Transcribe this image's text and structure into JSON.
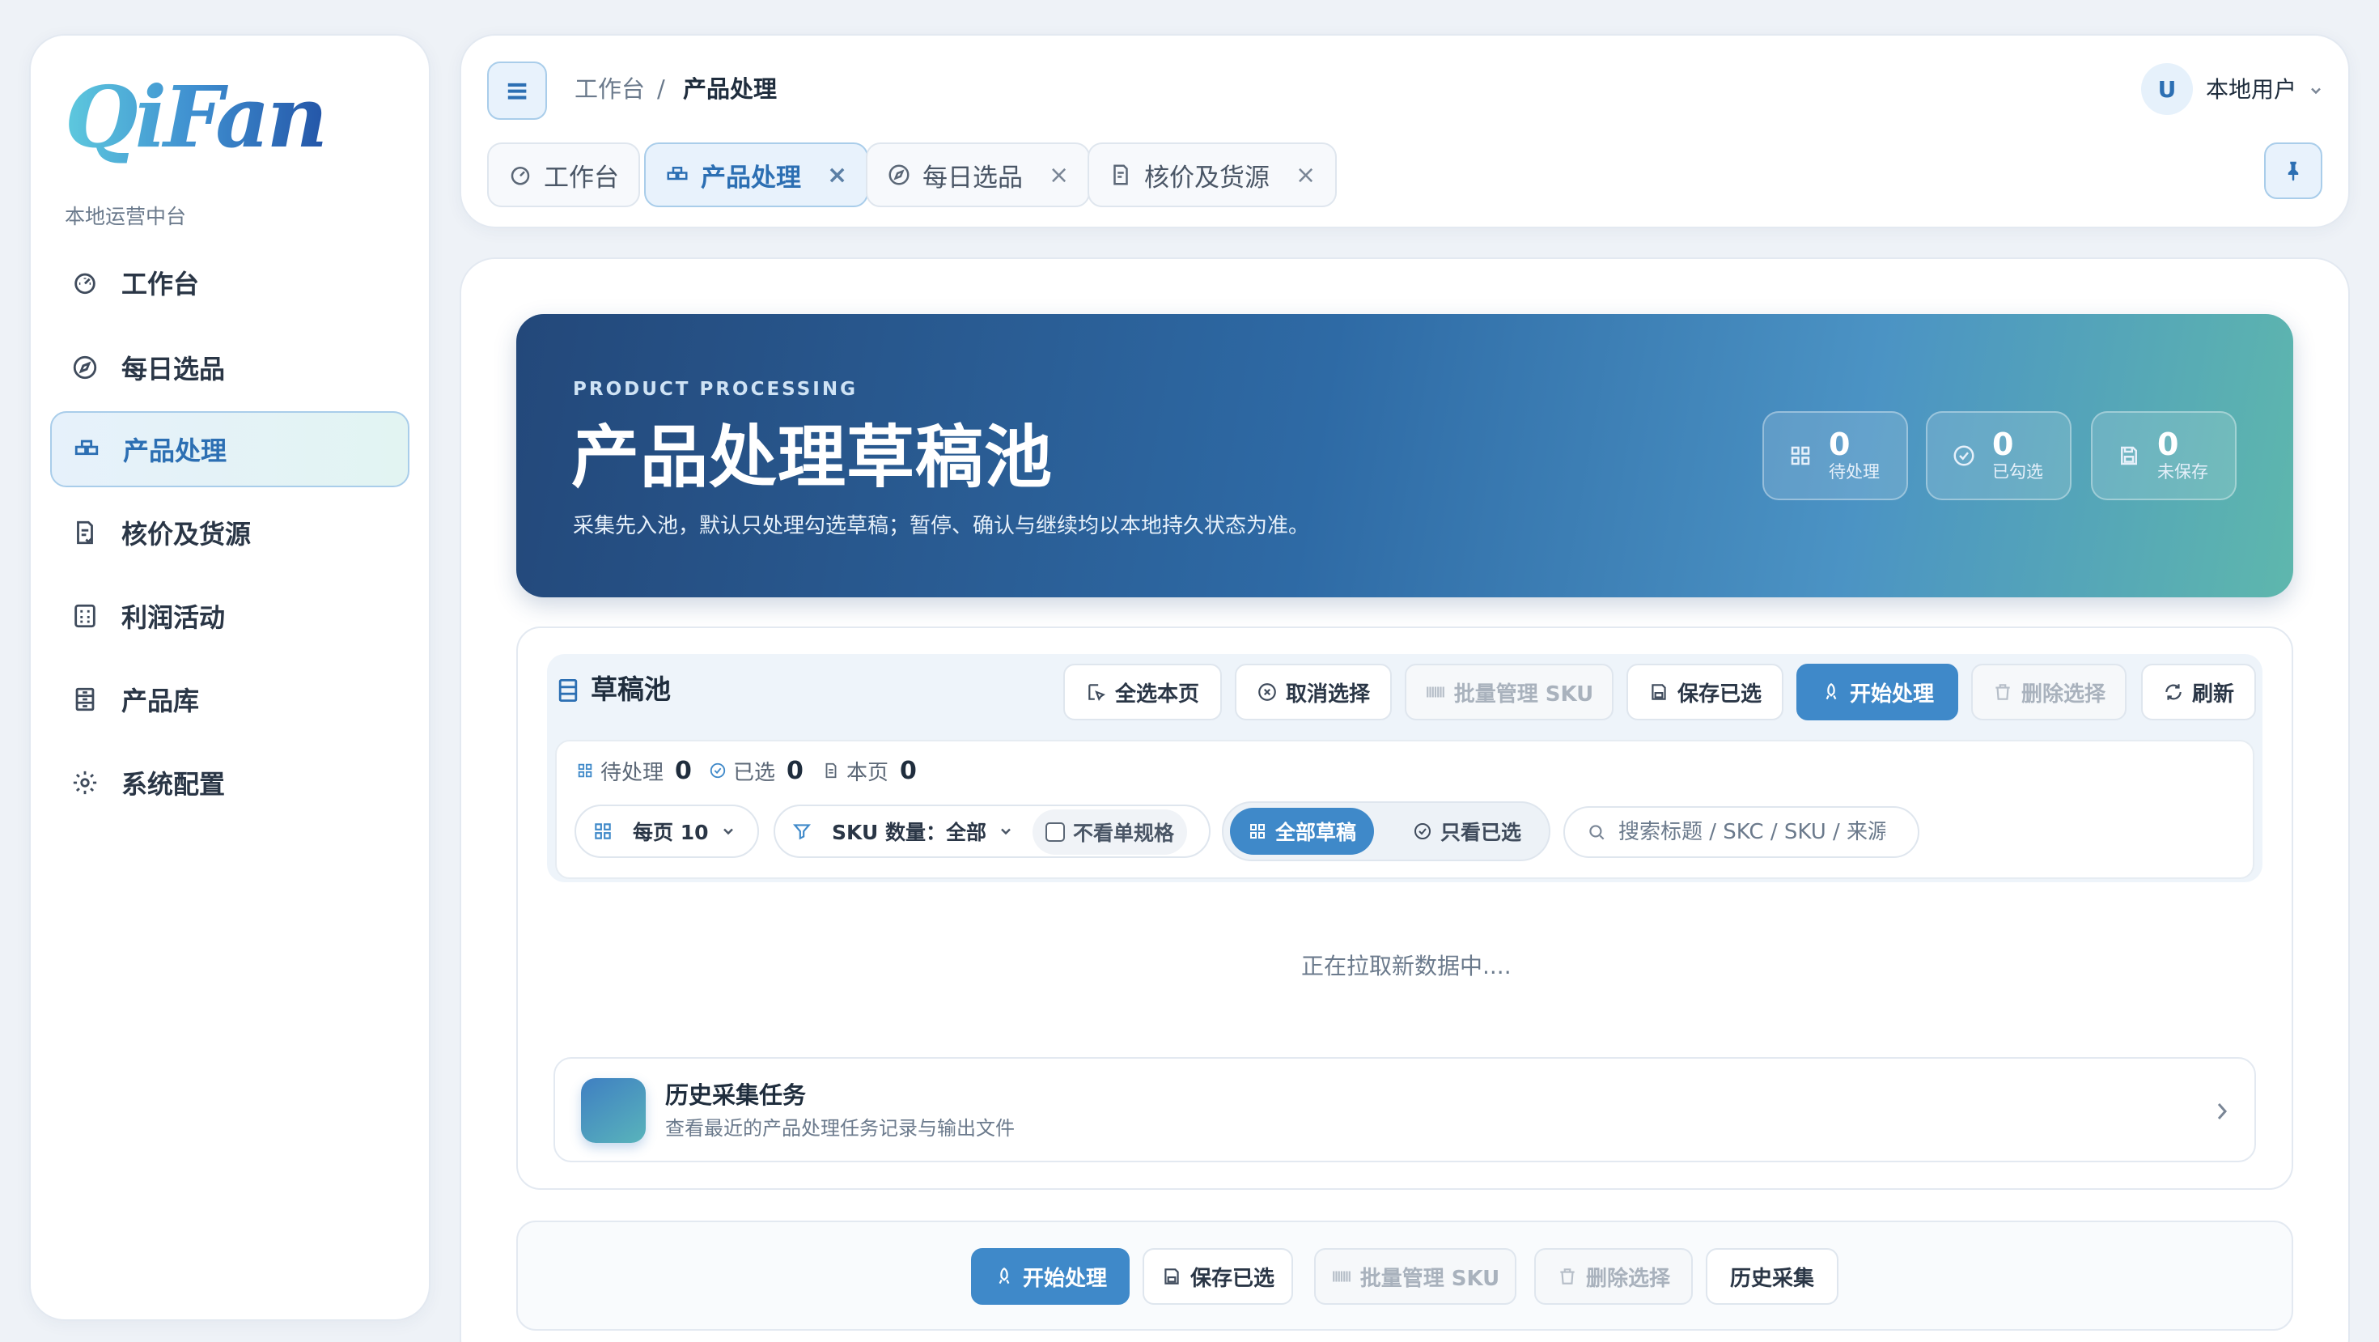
{
  "app": {
    "logo_text": "QiFan",
    "section_label": "本地运营中台"
  },
  "sidebar": {
    "items": [
      {
        "label": "工作台",
        "icon": "dashboard-icon"
      },
      {
        "label": "每日选品",
        "icon": "compass-icon"
      },
      {
        "label": "产品处理",
        "icon": "product-icon",
        "active": true
      },
      {
        "label": "核价及货源",
        "icon": "document-check-icon"
      },
      {
        "label": "利润活动",
        "icon": "calculator-icon"
      },
      {
        "label": "产品库",
        "icon": "archive-icon"
      },
      {
        "label": "系统配置",
        "icon": "gear-icon"
      }
    ]
  },
  "header": {
    "breadcrumb": [
      "工作台",
      "/",
      "产品处理"
    ],
    "user_initial": "U",
    "user_name": "本地用户",
    "tabs": [
      {
        "label": "工作台",
        "closable": false
      },
      {
        "label": "产品处理",
        "closable": true,
        "active": true
      },
      {
        "label": "每日选品",
        "closable": true
      },
      {
        "label": "核价及货源",
        "closable": true
      }
    ],
    "close_glyph": "×",
    "menu_glyph": "≡"
  },
  "hero": {
    "eyebrow": "PRODUCT PROCESSING",
    "title": "产品处理草稿池",
    "description": "采集先入池，默认只处理勾选草稿；暂停、确认与继续均以本地持久状态为准。",
    "stats": [
      {
        "value": "0",
        "label": "待处理"
      },
      {
        "value": "0",
        "label": "已勾选"
      },
      {
        "value": "0",
        "label": "未保存"
      }
    ]
  },
  "pool": {
    "title": "草稿池",
    "toolbar": {
      "select_page": "全选本页",
      "cancel_select": "取消选择",
      "batch_sku": "批量管理 SKU",
      "save_selected": "保存已选",
      "start_process": "开始处理",
      "delete_selected": "删除选择",
      "refresh": "刷新"
    },
    "counts": [
      {
        "label": "待处理",
        "value": "0"
      },
      {
        "label": "已选",
        "value": "0"
      },
      {
        "label": "本页",
        "value": "0"
      }
    ],
    "filters": {
      "per_page": "每页 10",
      "sku_count": "SKU 数量：全部",
      "hide_single": "不看单规格",
      "seg_all": "全部草稿",
      "seg_selected": "只看已选",
      "search_placeholder": "搜索标题 / SKC / SKU / 来源"
    },
    "loading_text": "正在拉取新数据中....",
    "history": {
      "title": "历史采集任务",
      "subtitle": "查看最近的产品处理任务记录与输出文件"
    }
  },
  "footer": {
    "start_process": "开始处理",
    "save_selected": "保存已选",
    "batch_sku": "批量管理 SKU",
    "delete_selected": "删除选择",
    "history": "历史采集"
  },
  "colors": {
    "accent": "#3f89c9",
    "hero_start": "#23487a",
    "hero_end": "#5eb7ad",
    "page_bg": "#eef2f7"
  }
}
